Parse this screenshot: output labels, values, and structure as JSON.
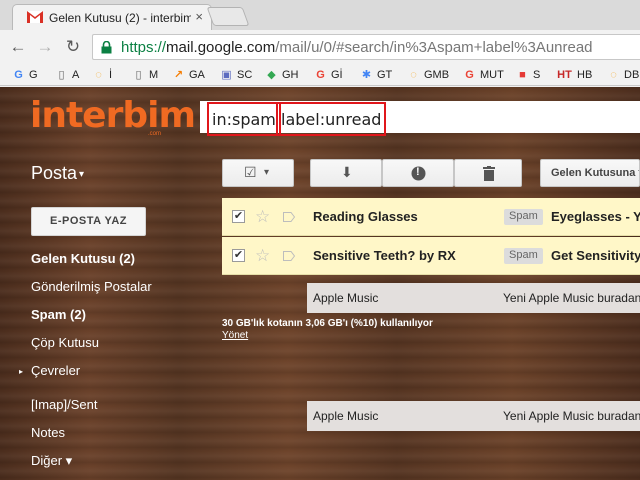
{
  "browser": {
    "tab_title": "Gelen Kutusu (2) - interbim",
    "tab_close": "×",
    "url_scheme": "https://",
    "url_host": "mail.google.com",
    "url_path": "/mail/u/0/#search/in%3Aspam+label%3Aunread",
    "back": "←",
    "forward": "→",
    "reload": "↻"
  },
  "bookmarks": [
    {
      "icon": "G",
      "label": "G",
      "color": "#4285f4"
    },
    {
      "icon": "▯",
      "label": "A",
      "color": "#666666"
    },
    {
      "icon": "◌",
      "label": "İ",
      "color": "#f5a623"
    },
    {
      "icon": "▯",
      "label": "M",
      "color": "#666666"
    },
    {
      "icon": "↗",
      "label": "GA",
      "color": "#f57c00"
    },
    {
      "icon": "▣",
      "label": "SC",
      "color": "#5c6bc0"
    },
    {
      "icon": "◆",
      "label": "GH",
      "color": "#34a853"
    },
    {
      "icon": "G",
      "label": "Gİ",
      "color": "#ea4335"
    },
    {
      "icon": "✱",
      "label": "GT",
      "color": "#4285f4"
    },
    {
      "icon": "◌",
      "label": "GMB",
      "color": "#f5a623"
    },
    {
      "icon": "G",
      "label": "MUT",
      "color": "#ea4335"
    },
    {
      "icon": "■",
      "label": "S",
      "color": "#e53935"
    },
    {
      "icon": "HT",
      "label": "HB",
      "color": "#c62828"
    },
    {
      "icon": "◌",
      "label": "DB",
      "color": "#f5a623"
    }
  ],
  "logo": {
    "text": "interbim",
    "sub": ".com"
  },
  "search": {
    "chip1": "in:spam",
    "chip2": "label:unread"
  },
  "sidebar": {
    "title": "Posta",
    "title_caret": "▾",
    "compose": "E-POSTA YAZ",
    "items": [
      {
        "label": "Gelen Kutusu (2)"
      },
      {
        "label": "Gönderilmiş Postalar"
      },
      {
        "label": "Spam (2)"
      },
      {
        "label": "Çöp Kutusu"
      },
      {
        "label": "Çevreler"
      },
      {
        "label": "[Imap]/Sent"
      },
      {
        "label": "Notes"
      },
      {
        "label": "Diğer ▾"
      }
    ],
    "expand_arrow": "▸"
  },
  "toolbar": {
    "select_check": "☑",
    "select_caret": "▾",
    "archive": "⬇",
    "report": "!",
    "delete": "🗑",
    "move_label": "Gelen Kutusuna t"
  },
  "messages": [
    {
      "check": "✔",
      "star": "☆",
      "sender": "Reading Glasses",
      "label": "Spam",
      "subject": "Eyeglasses - Y"
    },
    {
      "check": "✔",
      "star": "☆",
      "sender": "Sensitive Teeth? by RX",
      "label": "Spam",
      "subject": "Get Sensitivity"
    }
  ],
  "ads": [
    {
      "sender": "Apple Music",
      "text": "Yeni Apple Music buradan"
    },
    {
      "sender": "Apple Music",
      "text": "Yeni Apple Music buradan"
    }
  ],
  "quota": {
    "text": "30 GB'lık kotanın 3,06 GB'ı (%10) kullanılıyor",
    "manage": "Yönet"
  },
  "colors": {
    "accent": "#f06a22",
    "highlight": "#e0161b",
    "row_bg": "#fff7c8"
  }
}
